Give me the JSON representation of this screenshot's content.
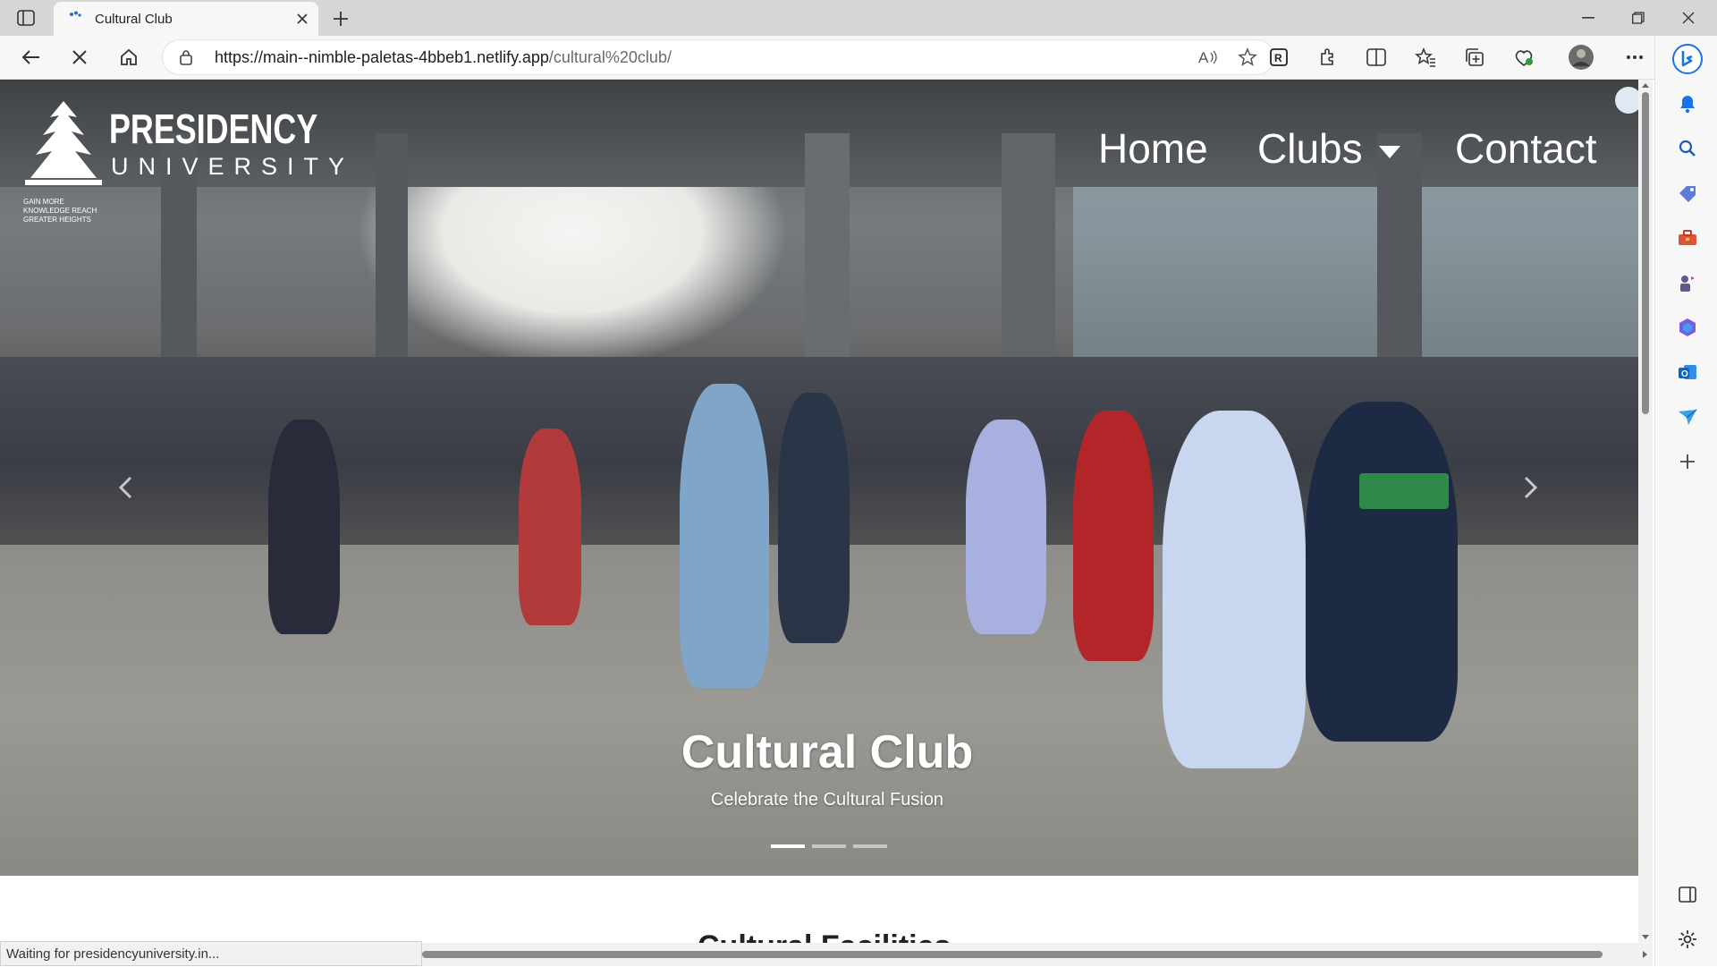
{
  "browser": {
    "tab_title": "Cultural Club",
    "url_host": "https://main--nimble-paletas-4bbeb1.netlify.app",
    "url_path": "/cultural%20club/",
    "status_text": "Waiting for presidencyuniversity.in..."
  },
  "site": {
    "logo_name": "PRESIDENCY",
    "logo_sub": "UNIVERSITY",
    "logo_tagline": "GAIN MORE KNOWLEDGE REACH GREATER HEIGHTS",
    "nav": {
      "home": "Home",
      "clubs": "Clubs",
      "contact": "Contact"
    }
  },
  "hero": {
    "title": "Cultural Club",
    "subtitle": "Celebrate the Cultural Fusion",
    "slides_total": 3,
    "active_slide": 1
  },
  "section": {
    "title": "Cultural Facilities"
  },
  "colors": {
    "accent_bing": "#1a73e8",
    "nav_text": "#ffffff"
  }
}
